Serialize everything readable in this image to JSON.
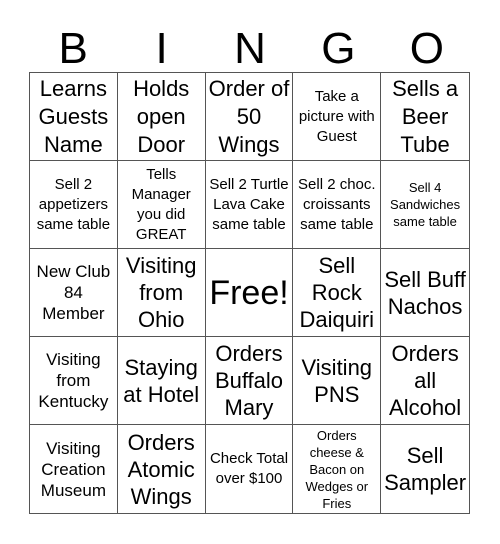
{
  "header": [
    "B",
    "I",
    "N",
    "G",
    "O"
  ],
  "cells": [
    {
      "text": "Learns Guests Name",
      "size": "s-xl"
    },
    {
      "text": "Holds open Door",
      "size": "s-xl"
    },
    {
      "text": "Order of 50 Wings",
      "size": "s-xl"
    },
    {
      "text": "Take a picture with Guest",
      "size": "s-s"
    },
    {
      "text": "Sells a Beer Tube",
      "size": "s-xl"
    },
    {
      "text": "Sell 2 appetizers same table",
      "size": "s-s"
    },
    {
      "text": "Tells Manager you did GREAT",
      "size": "s-s"
    },
    {
      "text": "Sell 2 Turtle Lava Cake same table",
      "size": "s-s"
    },
    {
      "text": "Sell 2 choc. croissants same table",
      "size": "s-s"
    },
    {
      "text": "Sell 4 Sandwiches same table",
      "size": "s-xxs"
    },
    {
      "text": "New Club 84 Member",
      "size": "s-m"
    },
    {
      "text": "Visiting from Ohio",
      "size": "s-l"
    },
    {
      "text": "Free!",
      "size": "s-free"
    },
    {
      "text": "Sell Rock Daiquiri",
      "size": "s-l"
    },
    {
      "text": "Sell Buff Nachos",
      "size": "s-l"
    },
    {
      "text": "Visiting from Kentucky",
      "size": "s-m"
    },
    {
      "text": "Staying at Hotel",
      "size": "s-l"
    },
    {
      "text": "Orders Buffalo Mary",
      "size": "s-l"
    },
    {
      "text": "Visiting PNS",
      "size": "s-l"
    },
    {
      "text": "Orders all Alcohol",
      "size": "s-l"
    },
    {
      "text": "Visiting Creation Museum",
      "size": "s-m"
    },
    {
      "text": "Orders Atomic Wings",
      "size": "s-l"
    },
    {
      "text": "Check Total over $100",
      "size": "s-s"
    },
    {
      "text": "Orders cheese & Bacon on Wedges or Fries",
      "size": "s-xxs"
    },
    {
      "text": "Sell Sampler",
      "size": "s-l"
    }
  ]
}
